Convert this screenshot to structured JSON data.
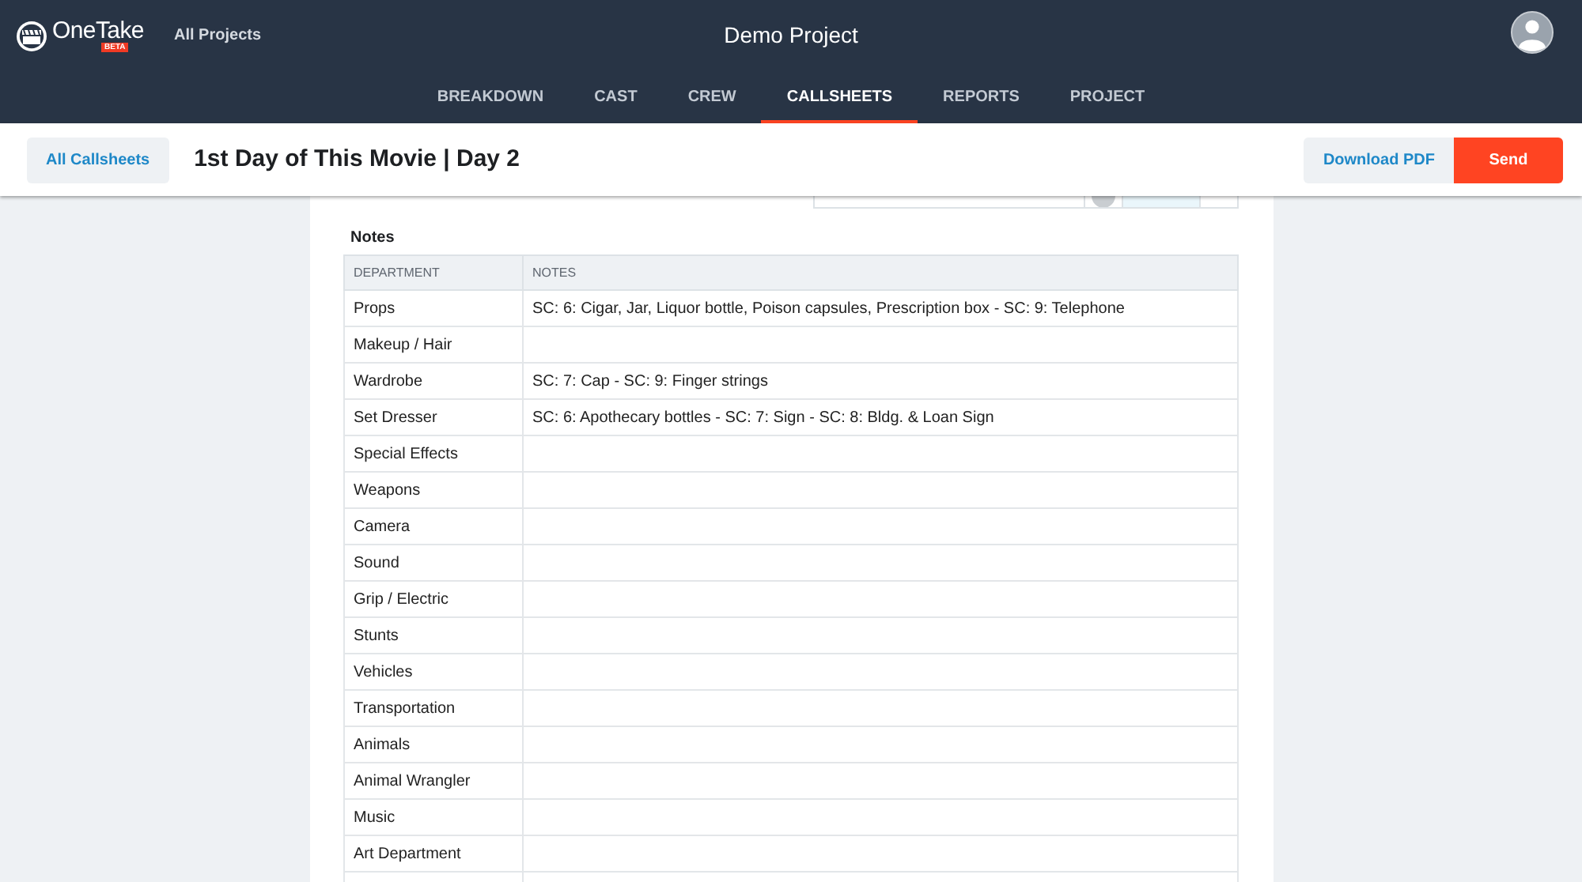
{
  "header": {
    "logo": {
      "name": "OneTake",
      "badge": "BETA"
    },
    "all_projects_link": "All Projects",
    "project_title": "Demo Project"
  },
  "nav_tabs": [
    {
      "label": "BREAKDOWN",
      "selected": false
    },
    {
      "label": "CAST",
      "selected": false
    },
    {
      "label": "CREW",
      "selected": false
    },
    {
      "label": "CALLSHEETS",
      "selected": true
    },
    {
      "label": "REPORTS",
      "selected": false
    },
    {
      "label": "PROJECT",
      "selected": false
    }
  ],
  "toolbar": {
    "back_button": "All Callsheets",
    "title": "1st Day of This Movie | Day 2",
    "buttons": [
      {
        "label": "Download PDF",
        "kind": "secondary"
      },
      {
        "label": "Send",
        "kind": "primary"
      }
    ]
  },
  "notes": {
    "heading": "Notes",
    "columns": [
      "DEPARTMENT",
      "NOTES"
    ],
    "rows": [
      {
        "department": "Props",
        "notes": "SC: 6: Cigar, Jar, Liquor bottle, Poison capsules, Prescription box - SC: 9: Telephone"
      },
      {
        "department": "Makeup / Hair"
      },
      {
        "department": "Wardrobe",
        "notes": "SC: 7: Cap - SC: 9: Finger strings"
      },
      {
        "department": "Set Dresser",
        "notes": "SC: 6: Apothecary bottles - SC: 7: Sign - SC: 8: Bldg. & Loan Sign"
      },
      {
        "department": "Special Effects"
      },
      {
        "department": "Weapons"
      },
      {
        "department": "Camera"
      },
      {
        "department": "Sound"
      },
      {
        "department": "Grip / Electric"
      },
      {
        "department": "Stunts"
      },
      {
        "department": "Vehicles"
      },
      {
        "department": "Transportation"
      },
      {
        "department": "Animals"
      },
      {
        "department": "Animal Wrangler"
      },
      {
        "department": "Music"
      },
      {
        "department": "Art Department"
      }
    ]
  }
}
